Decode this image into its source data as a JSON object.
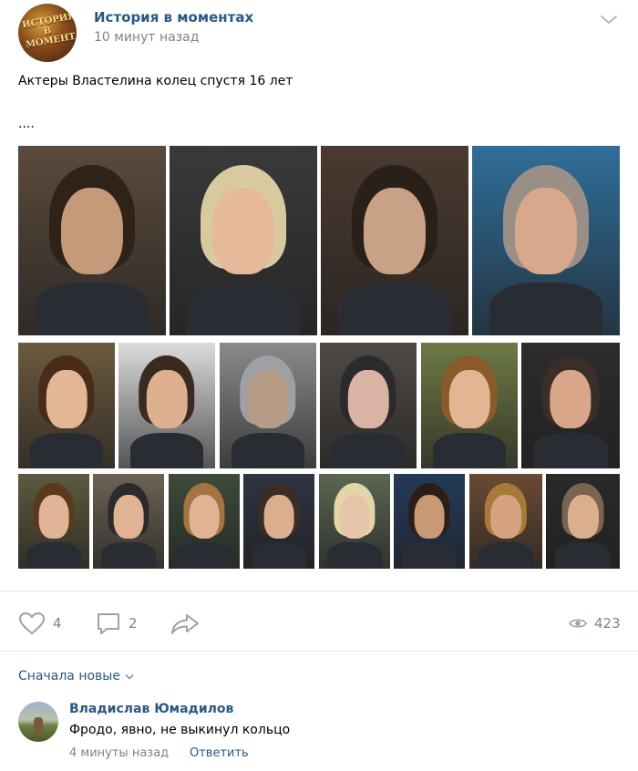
{
  "post": {
    "group_name": "История в моментах",
    "avatar_logo_text": "ИСТОРИЯ В МОМЕНТАХ",
    "time": "10 минут назад",
    "text": "Актеры Властелина колец спустя 16 лет",
    "dots": "....",
    "photos": [
      {
        "id": "aragorn-then",
        "bg": "#5a4a3c",
        "skin": "#c49a7a",
        "hair": "#2e2219"
      },
      {
        "id": "viggo-now",
        "bg": "#3a3a3a",
        "skin": "#e6b99a",
        "hair": "#d8c9a0"
      },
      {
        "id": "elrond-then",
        "bg": "#4b3a30",
        "skin": "#c9a184",
        "hair": "#2a201a"
      },
      {
        "id": "hugo-now",
        "bg": "#2f6e9a",
        "skin": "#d7a88b",
        "hair": "#9a8f86"
      },
      {
        "id": "frodo-then",
        "bg": "#6b5a3e",
        "skin": "#e3b796",
        "hair": "#4a2a18"
      },
      {
        "id": "elijah-now",
        "bg": "#dcdcdc",
        "skin": "#ddb08f",
        "hair": "#3a2a20"
      },
      {
        "id": "gandalf-then",
        "bg": "#8a8a8a",
        "skin": "#b79c88",
        "hair": "#9ea0a4"
      },
      {
        "id": "ian-now",
        "bg": "#4f4a46",
        "skin": "#d9b3a3",
        "hair": "#2b2b2b"
      },
      {
        "id": "sam-then",
        "bg": "#6e7a45",
        "skin": "#e2b593",
        "hair": "#8a5a2a"
      },
      {
        "id": "sean-now",
        "bg": "#2c2c2c",
        "skin": "#d9a68a",
        "hair": "#3a2e28"
      },
      {
        "id": "merry-then",
        "bg": "#5c5a3e",
        "skin": "#e2b497",
        "hair": "#5a3a1c"
      },
      {
        "id": "dom-now-hat",
        "bg": "#6d6255",
        "skin": "#e0b394",
        "hair": "#2b2b2b"
      },
      {
        "id": "pippin-then",
        "bg": "#3e4a3a",
        "skin": "#e0b394",
        "hair": "#a37440"
      },
      {
        "id": "billy-now",
        "bg": "#2f3342",
        "skin": "#dcae90",
        "hair": "#3b2c24"
      },
      {
        "id": "legolas-then",
        "bg": "#5b6652",
        "skin": "#e6c5aa",
        "hair": "#e2d6a6"
      },
      {
        "id": "orlando-now",
        "bg": "#243a5a",
        "skin": "#c99874",
        "hair": "#2a1e16"
      },
      {
        "id": "boromir-then",
        "bg": "#6a4a34",
        "skin": "#d5a380",
        "hair": "#a87a3a"
      },
      {
        "id": "sean-bean-now",
        "bg": "#2a2a2a",
        "skin": "#dcae90",
        "hair": "#7a6450"
      }
    ]
  },
  "actions": {
    "likes": "4",
    "comments": "2",
    "views": "423"
  },
  "comments": {
    "sort_label": "Сначала новые",
    "items": [
      {
        "author": "Владислав Юмадилов",
        "text": "Фродо, явно, не выкинул кольцо",
        "time": "4 минуты назад",
        "reply": "Ответить"
      }
    ]
  },
  "colors": {
    "link": "#2a5885",
    "muted": "#828282",
    "divider": "#e7e8ec"
  }
}
